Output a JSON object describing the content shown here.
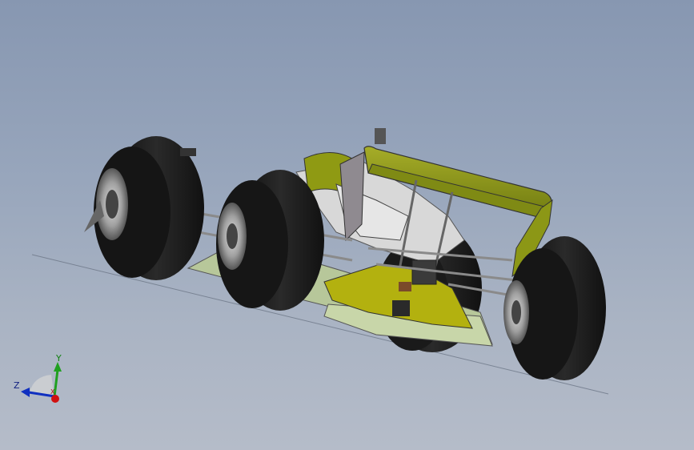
{
  "viewport": {
    "background_top": "#8797b1",
    "background_bottom": "#b5bcc9"
  },
  "model": {
    "body_color": "#9aa21a",
    "tire_color": "#1c1c1c",
    "chassis_color": "#b7c79a"
  },
  "triad": {
    "x_label": "X",
    "y_label": "Y",
    "z_label": "Z",
    "x_color": "#d01010",
    "y_color": "#20a020",
    "z_color": "#1030c0"
  }
}
